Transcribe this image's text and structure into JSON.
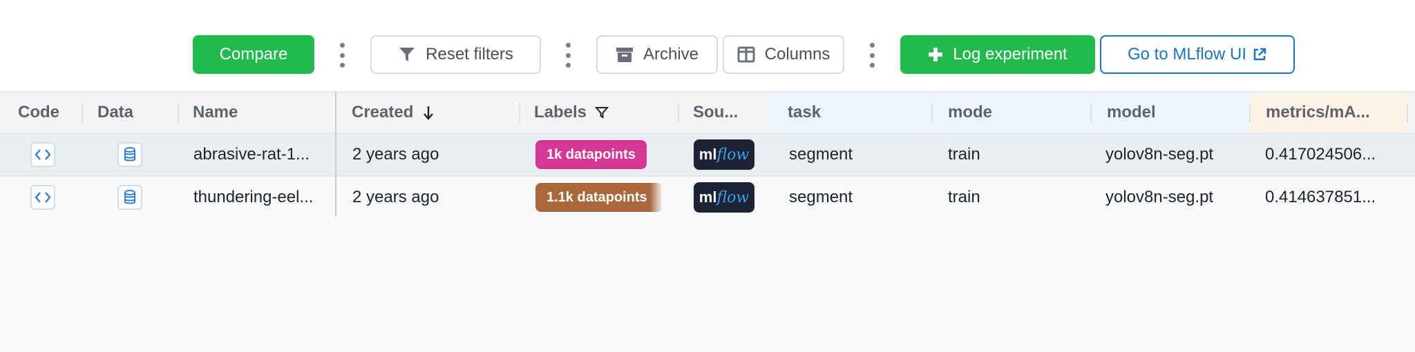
{
  "toolbar": {
    "compare_label": "Compare",
    "reset_filters_label": "Reset filters",
    "archive_label": "Archive",
    "columns_label": "Columns",
    "log_experiment_label": "Log experiment",
    "mlflow_label": "Go to MLflow UI"
  },
  "columns": {
    "code": "Code",
    "data": "Data",
    "name": "Name",
    "created": "Created",
    "labels": "Labels",
    "source": "Sou...",
    "task": "task",
    "mode": "mode",
    "model": "model",
    "metric": "metrics/mA..."
  },
  "rows": [
    {
      "name": "abrasive-rat-1...",
      "created": "2 years ago",
      "label": "1k datapoints",
      "label_color": "#d63794",
      "source_ml": "ml",
      "source_flow": "flow",
      "task": "segment",
      "mode": "train",
      "model": "yolov8n-seg.pt",
      "metric": "0.417024506..."
    },
    {
      "name": "thundering-eel...",
      "created": "2 years ago",
      "label": "1.1k datapoints",
      "label_color": "#a8683c",
      "source_ml": "ml",
      "source_flow": "flow",
      "task": "segment",
      "mode": "train",
      "model": "yolov8n-seg.pt",
      "metric": "0.414637851..."
    }
  ],
  "colors": {
    "primary_green": "#22b94e",
    "link_blue": "#1c72c4",
    "param_header_bg": "#edf4fd",
    "metric_header_bg": "#fdf3e8"
  }
}
